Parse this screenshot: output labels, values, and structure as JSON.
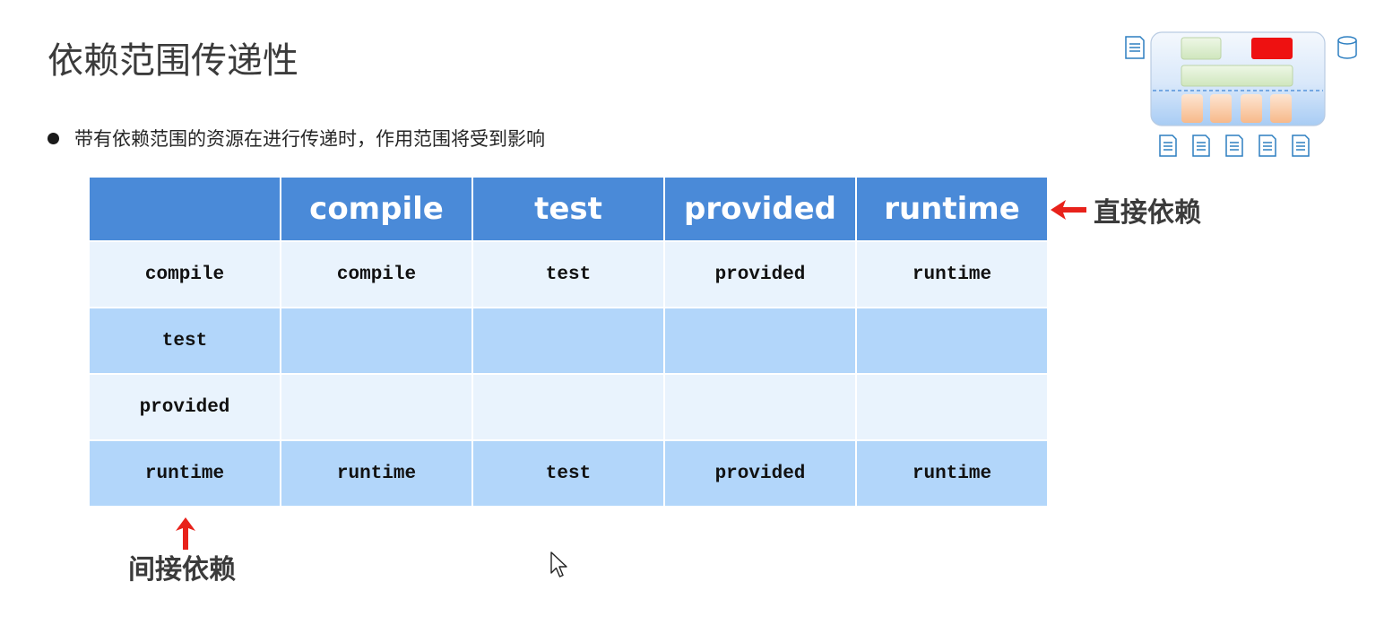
{
  "title": "依赖范围传递性",
  "bullet": "带有依赖范围的资源在进行传递时，作用范围将受到影响",
  "table": {
    "header": [
      "",
      "compile",
      "test",
      "provided",
      "runtime"
    ],
    "rows": [
      [
        "compile",
        "compile",
        "test",
        "provided",
        "runtime"
      ],
      [
        "test",
        "",
        "",
        "",
        ""
      ],
      [
        "provided",
        "",
        "",
        "",
        ""
      ],
      [
        "runtime",
        "runtime",
        "test",
        "provided",
        "runtime"
      ]
    ]
  },
  "labels": {
    "direct": "直接依赖",
    "indirect": "间接依赖"
  },
  "colors": {
    "header_bg": "#4a8ad8",
    "row_light": "#e9f3fd",
    "row_dark": "#b2d6fa",
    "arrow": "#e8221b"
  },
  "icons": {
    "direct_arrow": "arrow-left-icon",
    "indirect_arrow": "arrow-up-icon",
    "cursor": "mouse-pointer-icon",
    "diagram": "dependency-structure-diagram-icon"
  }
}
